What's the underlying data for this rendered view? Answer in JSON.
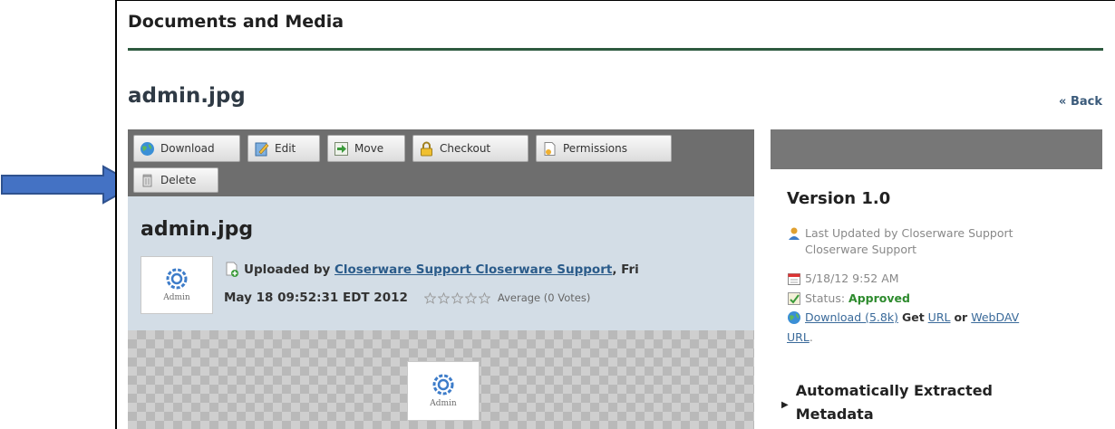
{
  "portlet": {
    "title": "Documents and Media"
  },
  "document": {
    "heading": "admin.jpg",
    "back_label": "« Back"
  },
  "toolbar": {
    "download": "Download",
    "edit": "Edit",
    "move": "Move",
    "checkout": "Checkout",
    "permissions": "Permissions",
    "delete": "Delete"
  },
  "info": {
    "title": "admin.jpg",
    "thumb_label": "Admin",
    "uploaded_by_prefix": "Uploaded by",
    "uploader": "Closerware Support Closerware Support",
    "date_part1": ", Fri",
    "date_part2": "May 18 09:52:31 EDT 2012",
    "average": "Average (0 Votes)",
    "rating": 0,
    "max_rating": 5
  },
  "preview": {
    "thumb_label": "Admin"
  },
  "version_panel": {
    "version": "Version 1.0",
    "last_updated_line1": "Last Updated by Closerware Support",
    "last_updated_line2": "Closerware Support",
    "date": "5/18/12 9:52 AM",
    "status_label": "Status:",
    "status_value": "Approved",
    "download_link": "Download (5.8k)",
    "get_text": "Get",
    "url_link": "URL",
    "or_text": "or",
    "webdav_link": "WebDAV",
    "url2_link": "URL",
    "trailing": ".",
    "metadata_line1": "Automatically Extracted",
    "metadata_line2": "Metadata"
  },
  "colors": {
    "title_rule": "#2d5a3f",
    "toolbar_bg": "#6e6e6e",
    "info_bg": "#d3dde6",
    "annotation_arrow": "#4472c4",
    "approved": "#2e8b2e"
  }
}
